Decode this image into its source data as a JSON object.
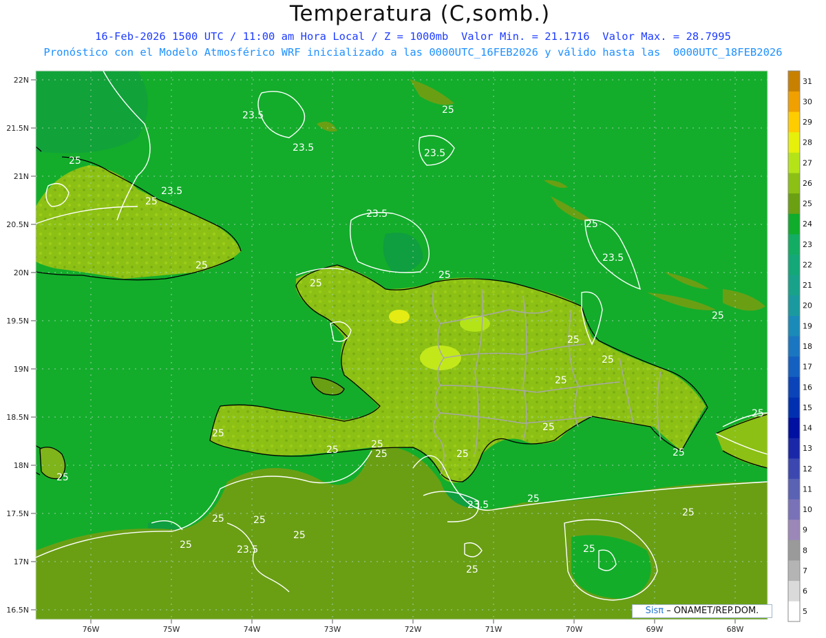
{
  "title": "Temperatura (C,somb.)",
  "subtitle_line1": "16-Feb-2026 1500 UTC / 11:00 am Hora Local / Z = 1000mb  Valor Min. = 21.1716  Valor Max. = 28.7995",
  "subtitle_line2": "Pronóstico con el Modelo Atmosférico WRF inicializado a las 0000UTC_16FEB2026 y válido hasta las  0000UTC_18FEB2026",
  "lat_labels": [
    "22N",
    "21.5N",
    "21N",
    "20.5N",
    "20N",
    "19.5N",
    "19N",
    "18.5N",
    "18N",
    "17.5N",
    "17N",
    "16.5N"
  ],
  "lon_labels": [
    "76W",
    "75W",
    "74W",
    "73W",
    "72W",
    "71W",
    "70W",
    "69W",
    "68W"
  ],
  "colorbar": {
    "labels": [
      "5",
      "6",
      "7",
      "8",
      "9",
      "10",
      "11",
      "12",
      "13",
      "14",
      "15",
      "16",
      "17",
      "18",
      "19",
      "20",
      "21",
      "22",
      "23",
      "24",
      "25",
      "26",
      "27",
      "28",
      "29",
      "30",
      "31"
    ],
    "colors": [
      "#ffffff",
      "#dadada",
      "#b4b4b4",
      "#9a9a9a",
      "#9b88b8",
      "#7a72b8",
      "#5a62b4",
      "#3c48b0",
      "#1a28a8",
      "#0010a0",
      "#0030b0",
      "#0a44b8",
      "#1460c0",
      "#1a76c0",
      "#1a8ab8",
      "#1a9a9e",
      "#18a28a",
      "#14a878",
      "#12ac62",
      "#10ac2c",
      "#6aa012",
      "#8cc014",
      "#b4e418",
      "#e6f00a",
      "#ffcc00",
      "#f0a000",
      "#c88000"
    ]
  },
  "contour_labels": [
    "23.5",
    "23.5",
    "23.5",
    "23.5",
    "23.5",
    "23.5",
    "23.5",
    "23.5",
    "25",
    "25",
    "25",
    "25",
    "25",
    "25",
    "25",
    "25",
    "25",
    "25",
    "25",
    "25",
    "25",
    "25",
    "25",
    "25",
    "25",
    "25",
    "25",
    "25",
    "25",
    "25",
    "25",
    "25",
    "25"
  ],
  "credit": {
    "brand": "Sisπ",
    "text": "– ONAMET/REP.DOM."
  }
}
